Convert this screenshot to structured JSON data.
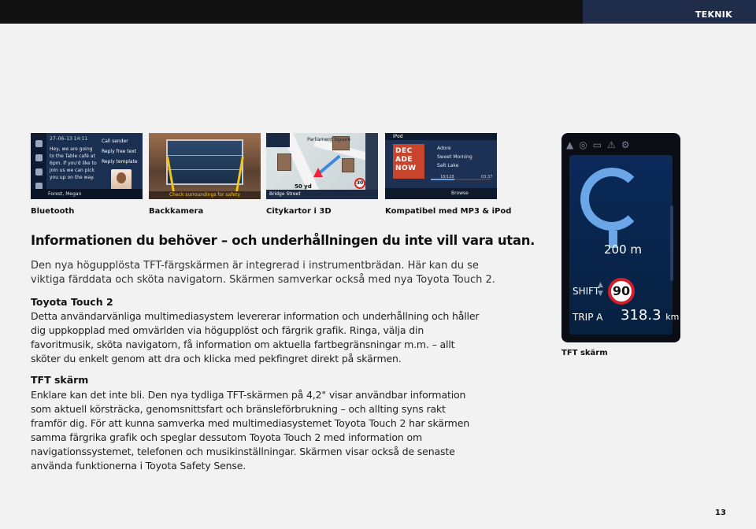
{
  "header": {
    "section": "TEKNIK"
  },
  "thumbnails": [
    {
      "caption": "Bluetooth"
    },
    {
      "caption": "Backkamera"
    },
    {
      "caption": "Citykartor i 3D"
    },
    {
      "caption": "Kompatibel med MP3 & iPod"
    }
  ],
  "bluetooth_screen": {
    "date": "27–06–13  14:11",
    "message": "Hey, we are going to the Table café at 6pm. If you'd like to join us we can pick you up on the way.",
    "menu": [
      "Call sender",
      "Reply free text",
      "Reply template"
    ],
    "caller": "Forest, Megan"
  },
  "camera_screen": {
    "warning": "Check surroundings for safety"
  },
  "map_screen": {
    "place": "Parliament Square",
    "distance": "50 yd",
    "street": "Bridge Street",
    "speed_limit": "30"
  },
  "ipod_screen": {
    "title": "iPod",
    "album_art": "DEC ADE NOW",
    "tracks": [
      "Adore",
      "Sweet Morning",
      "Salt Lake"
    ],
    "counter": "18/128",
    "time": "03:37",
    "browse": "Browse"
  },
  "main": {
    "heading": "Informationen du behöver – och underhållningen du inte vill vara utan.",
    "intro": "Den nya högupplösta TFT-färgskärmen är integrerad i instrumentbrädan. Här kan du se viktiga färddata och sköta navigatorn. Skärmen samverkar också med nya Toyota Touch 2.",
    "touch_heading": "Toyota Touch 2",
    "touch_text": "Detta användarvänliga multimediasystem levererar information och underhållning och håller dig uppkopplad med omvärlden via högupplöst och färgrik grafik. Ringa, välja din favoritmusik, sköta navigatorn, få information om aktuella fartbegränsningar m.m. – allt sköter du enkelt genom att dra och klicka med pekfingret direkt på skärmen.",
    "tft_heading": "TFT skärm",
    "tft_text": "Enklare kan det inte bli. Den nya tydliga TFT-skärmen på 4,2\" visar användbar information som aktuell körsträcka, genomsnittsfart och bränsleförbrukning – och allting syns rakt framför dig. För att kunna samverka med multimediasystemet Toyota Touch 2 har skärmen samma färgrika grafik och speglar dessutom Toyota Touch 2 med information om navigationssystemet, telefonen och musikinställningar. Skärmen visar också de senaste använda funktionerna i Toyota Safety Sense."
  },
  "tft_display": {
    "distance": "200 m",
    "shift_label": "SHIFT",
    "speed_limit": "90",
    "trip_label": "TRIP A",
    "trip_value": "318.3",
    "trip_unit": "km",
    "caption": "TFT skärm"
  },
  "page_number": "13"
}
